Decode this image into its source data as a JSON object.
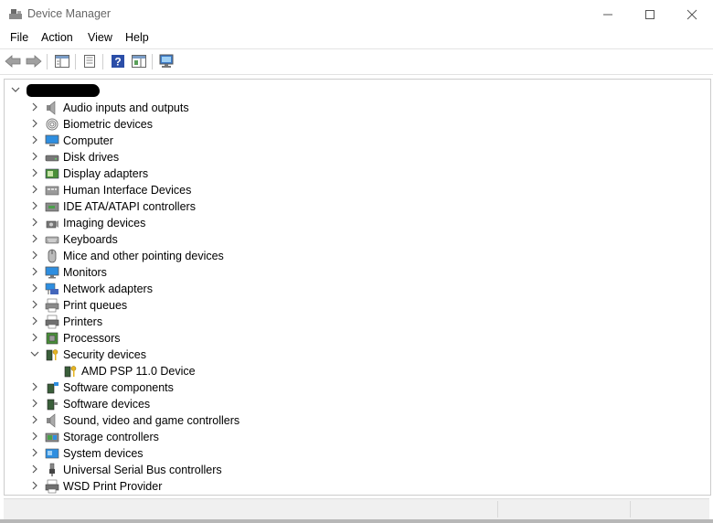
{
  "window": {
    "title": "Device Manager"
  },
  "menu": [
    "File",
    "Action",
    "View",
    "Help"
  ],
  "tree": {
    "categories": [
      {
        "label": "Audio inputs and outputs",
        "icon": "speaker-icon",
        "expanded": false
      },
      {
        "label": "Biometric devices",
        "icon": "fingerprint-icon",
        "expanded": false
      },
      {
        "label": "Computer",
        "icon": "computer-icon",
        "expanded": false
      },
      {
        "label": "Disk drives",
        "icon": "disk-drive-icon",
        "expanded": false
      },
      {
        "label": "Display adapters",
        "icon": "display-adapter-icon",
        "expanded": false
      },
      {
        "label": "Human Interface Devices",
        "icon": "hid-icon",
        "expanded": false
      },
      {
        "label": "IDE ATA/ATAPI controllers",
        "icon": "ide-controller-icon",
        "expanded": false
      },
      {
        "label": "Imaging devices",
        "icon": "camera-icon",
        "expanded": false
      },
      {
        "label": "Keyboards",
        "icon": "keyboard-icon",
        "expanded": false
      },
      {
        "label": "Mice and other pointing devices",
        "icon": "mouse-icon",
        "expanded": false
      },
      {
        "label": "Monitors",
        "icon": "monitor-icon",
        "expanded": false
      },
      {
        "label": "Network adapters",
        "icon": "network-icon",
        "expanded": false
      },
      {
        "label": "Print queues",
        "icon": "print-queue-icon",
        "expanded": false
      },
      {
        "label": "Printers",
        "icon": "printer-icon",
        "expanded": false
      },
      {
        "label": "Processors",
        "icon": "processor-icon",
        "expanded": false
      },
      {
        "label": "Security devices",
        "icon": "security-device-icon",
        "expanded": true
      },
      {
        "label": "AMD PSP 11.0 Device",
        "icon": "security-device-icon",
        "child": true
      },
      {
        "label": "Software components",
        "icon": "software-component-icon",
        "expanded": false
      },
      {
        "label": "Software devices",
        "icon": "software-device-icon",
        "expanded": false
      },
      {
        "label": "Sound, video and game controllers",
        "icon": "speaker-icon",
        "expanded": false
      },
      {
        "label": "Storage controllers",
        "icon": "storage-controller-icon",
        "expanded": false
      },
      {
        "label": "System devices",
        "icon": "system-device-icon",
        "expanded": false
      },
      {
        "label": "Universal Serial Bus controllers",
        "icon": "usb-icon",
        "expanded": false
      },
      {
        "label": "WSD Print Provider",
        "icon": "printer-icon",
        "expanded": false
      }
    ]
  },
  "colors": {
    "accent": "#1e7fd6",
    "chevron": "#555555"
  }
}
